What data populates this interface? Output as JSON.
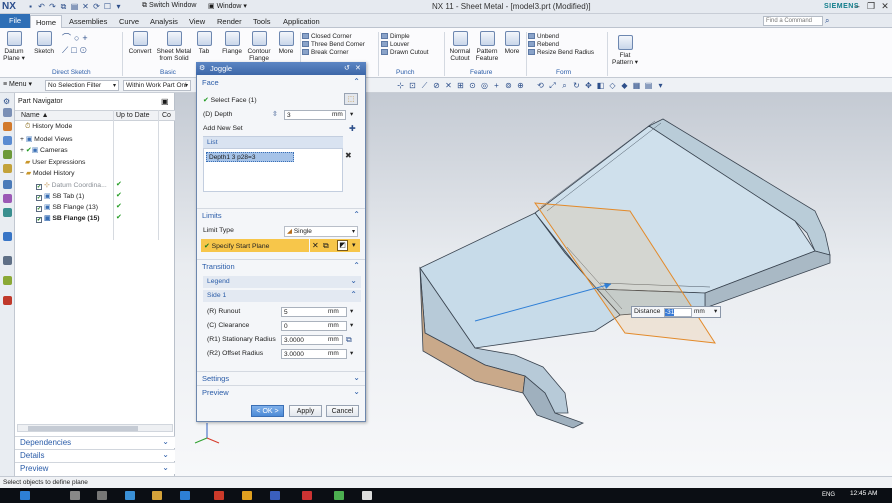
{
  "app": {
    "logo": "NX",
    "title": "NX 11 - Sheet Metal - [model3.prt (Modified)]",
    "brand": "SIEMENS",
    "switch_window": "Switch Window",
    "window_menu": "Window"
  },
  "tabs": [
    "Home",
    "Assemblies",
    "Curve",
    "Analysis",
    "View",
    "Render",
    "Tools",
    "Application"
  ],
  "file_tab": "File",
  "command_search_placeholder": "Find a Command",
  "ribbon": {
    "datum_plane": [
      "Datum",
      "Plane ▾"
    ],
    "sketch": "Sketch",
    "direct_sketch": "Direct Sketch",
    "convert": "Convert",
    "sheet_metal_from_solid": [
      "Sheet Metal",
      "from Solid"
    ],
    "tab": "Tab",
    "flange": "Flange",
    "contour": [
      "Contour",
      "Flange"
    ],
    "more1": "More",
    "basic": "Basic",
    "small1": [
      "Closed Corner",
      "Three Bend Corner",
      "Break Corner"
    ],
    "small2": [
      "Dimple",
      "Louver",
      "Drawn Cutout"
    ],
    "punch": "Punch",
    "normal_cutout": [
      "Normal",
      "Cutout"
    ],
    "pattern_feature": [
      "Pattern",
      "Feature"
    ],
    "more2": "More",
    "feature": "Feature",
    "small3": [
      "Unbend",
      "Rebend",
      "Resize Bend Radius"
    ],
    "form": "Form",
    "flat_pattern": [
      "Flat",
      "Pattern ▾"
    ]
  },
  "selection_bar": {
    "menu": "Menu ▾",
    "filter": "No Selection Filter",
    "scope": "Within Work Part Onl"
  },
  "navigator": {
    "title": "Part Navigator",
    "columns": [
      "Name",
      "Up to Date",
      "Co"
    ],
    "rows": [
      {
        "label": "History Mode",
        "indent": 0,
        "check": ""
      },
      {
        "label": "Model Views",
        "indent": 0,
        "check": ""
      },
      {
        "label": "Cameras",
        "indent": 0,
        "check": ""
      },
      {
        "label": "User Expressions",
        "indent": 0,
        "check": ""
      },
      {
        "label": "Model History",
        "indent": 0,
        "check": ""
      },
      {
        "label": "Datum Coordina...",
        "indent": 1,
        "check": "✔"
      },
      {
        "label": "SB Tab (1)",
        "indent": 1,
        "check": "✔"
      },
      {
        "label": "SB Flange (13)",
        "indent": 1,
        "check": "✔"
      },
      {
        "label": "SB Flange (15)",
        "indent": 1,
        "check": "✔"
      }
    ],
    "sections": [
      "Dependencies",
      "Details",
      "Preview"
    ]
  },
  "dialog": {
    "title": "Joggle",
    "face_section": "Face",
    "select_face": "Select Face (1)",
    "depth_label": "(D) Depth",
    "depth_value": "3",
    "depth_unit": "mm",
    "add_new_set": "Add New Set",
    "list_label": "List",
    "list_item": "Depth1  3   p28=3",
    "limits_section": "Limits",
    "limit_type_label": "Limit Type",
    "limit_type_value": "Single",
    "specify_start_plane": "Specify Start Plane",
    "transition_section": "Transition",
    "legend": "Legend",
    "side1": "Side 1",
    "runout_label": "(R) Runout",
    "runout_value": "5",
    "clearance_label": "(C) Clearance",
    "clearance_value": "0",
    "r1_label": "(R1) Stationary Radius",
    "r1_value": "3.0000",
    "r2_label": "(R2) Offset Radius",
    "r2_value": "3.0000",
    "unit": "mm",
    "settings_section": "Settings",
    "preview_section": "Preview",
    "ok": "< OK >",
    "apply": "Apply",
    "cancel": "Cancel"
  },
  "distance_popup": {
    "label": "Distance",
    "value": "-31",
    "unit": "mm"
  },
  "status": "Select objects to define plane",
  "taskbar": {
    "lang": "ENG",
    "time": "12:45 AM"
  }
}
